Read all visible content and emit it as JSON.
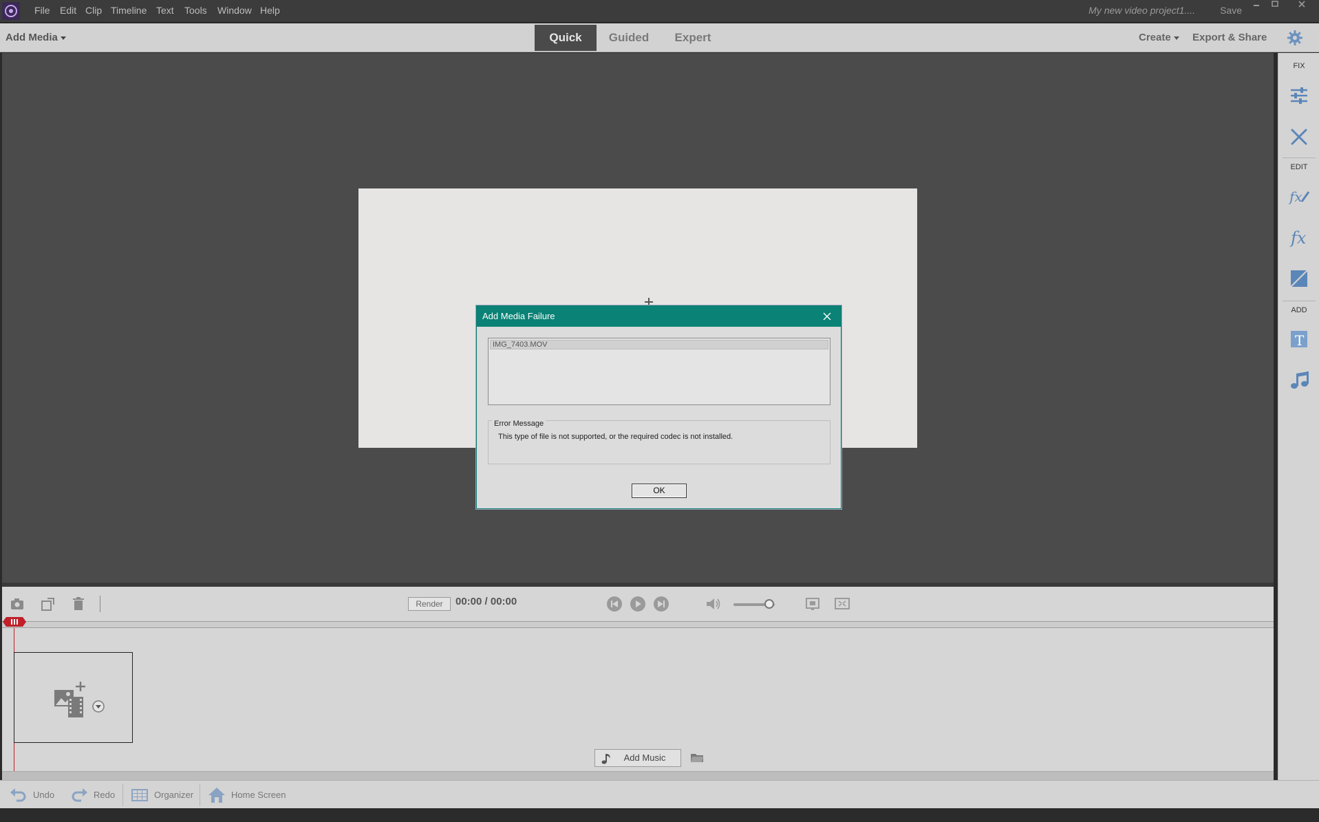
{
  "menu": {
    "items": [
      "File",
      "Edit",
      "Clip",
      "Timeline",
      "Text",
      "Tools",
      "Window",
      "Help"
    ]
  },
  "titlebar": {
    "project_name": "My new video project1....",
    "save_label": "Save"
  },
  "toolbar": {
    "add_media_label": "Add Media",
    "mode_tabs": [
      {
        "label": "Quick",
        "active": true
      },
      {
        "label": "Guided",
        "active": false
      },
      {
        "label": "Expert",
        "active": false
      }
    ],
    "create_label": "Create",
    "export_label": "Export & Share"
  },
  "right_panel": {
    "fix_heading": "FIX",
    "edit_heading": "EDIT",
    "add_heading": "ADD"
  },
  "timeline": {
    "render_label": "Render",
    "timecode": "00:00 / 00:00",
    "add_music_label": "Add Music"
  },
  "bottom_bar": {
    "undo_label": "Undo",
    "redo_label": "Redo",
    "organizer_label": "Organizer",
    "home_label": "Home Screen"
  },
  "dialog": {
    "title": "Add Media Failure",
    "files": [
      "IMG_7403.MOV"
    ],
    "error_heading": "Error Message",
    "error_message": "This type of file is not supported, or the required codec is not installed.",
    "ok_label": "OK"
  },
  "colors": {
    "dialog_titlebar": "#0a8275",
    "playhead": "#c0202a",
    "panel_icon": "#5b86b8"
  }
}
